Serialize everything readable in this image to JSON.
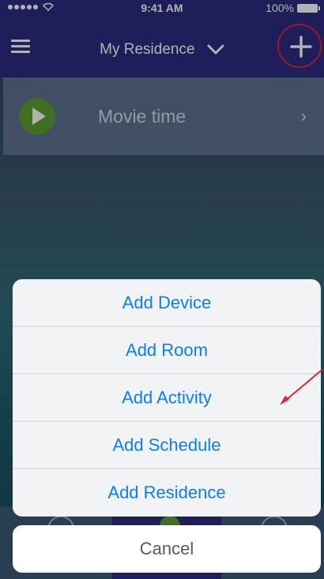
{
  "status_bar": {
    "time": "9:41 AM",
    "battery": "100%"
  },
  "header": {
    "title": "My Residence",
    "menu_icon": "hamburger-menu-icon",
    "dropdown_icon": "chevron-down-icon",
    "add_icon": "plus-icon"
  },
  "activity": {
    "label": "Movie time",
    "icon": "play-icon",
    "chevron": "›"
  },
  "action_sheet": {
    "items": [
      {
        "label": "Add Device"
      },
      {
        "label": "Add Room"
      },
      {
        "label": "Add Activity"
      },
      {
        "label": "Add Schedule"
      },
      {
        "label": "Add Residence"
      }
    ],
    "cancel_label": "Cancel"
  },
  "colors": {
    "nav_bg": "#2b2c83",
    "action_text": "#0a7dfa",
    "annotation": "#e0282b",
    "play_green": "#5aa032"
  }
}
